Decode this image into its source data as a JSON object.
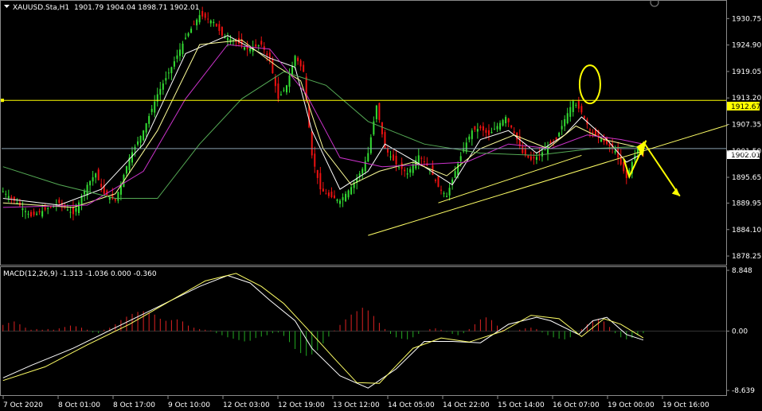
{
  "header": {
    "symbol": "XAUUSD.Sta,H1",
    "ohlc": "1901.79 1904.04 1898.71 1902.01"
  },
  "chart_data": [
    {
      "type": "candlestick",
      "title": "XAUUSD.Sta,H1",
      "ylim": [
        1876.5,
        1934.5
      ],
      "y_ticks": [
        "1930.75",
        "1924.90",
        "1919.05",
        "1913.20",
        "1907.35",
        "1901.50",
        "1895.65",
        "1889.95",
        "1884.10",
        "1878.25"
      ],
      "x_ticks": [
        "7 Oct 2020",
        "8 Oct 01:00",
        "8 Oct 17:00",
        "9 Oct 10:00",
        "12 Oct 03:00",
        "12 Oct 19:00",
        "13 Oct 12:00",
        "14 Oct 05:00",
        "14 Oct 22:00",
        "15 Oct 14:00",
        "16 Oct 07:00",
        "19 Oct 00:00",
        "19 Oct 16:00"
      ],
      "price_labels": {
        "resistance": "1912.67",
        "current": "1902.01"
      },
      "resistance_level": 1912.67,
      "current_price": 1902.01,
      "close_path": [
        [
          0,
          1892.5
        ],
        [
          5,
          1890.0
        ],
        [
          10,
          1887.0
        ],
        [
          15,
          1888.5
        ],
        [
          20,
          1890.0
        ],
        [
          25,
          1887.5
        ],
        [
          30,
          1894.0
        ],
        [
          33,
          1896.5
        ],
        [
          36,
          1892.0
        ],
        [
          40,
          1890.5
        ],
        [
          45,
          1900.0
        ],
        [
          50,
          1906.0
        ],
        [
          55,
          1914.0
        ],
        [
          60,
          1920.0
        ],
        [
          65,
          1926.5
        ],
        [
          70,
          1931.5
        ],
        [
          75,
          1930.0
        ],
        [
          78,
          1927.0
        ],
        [
          82,
          1926.0
        ],
        [
          87,
          1924.0
        ],
        [
          92,
          1925.0
        ],
        [
          95,
          1921.5
        ],
        [
          98,
          1913.0
        ],
        [
          101,
          1916.0
        ],
        [
          104,
          1922.5
        ],
        [
          107,
          1919.0
        ],
        [
          110,
          1900.5
        ],
        [
          113,
          1893.0
        ],
        [
          116,
          1891.5
        ],
        [
          120,
          1890.5
        ],
        [
          124,
          1893.5
        ],
        [
          128,
          1897.5
        ],
        [
          130,
          1901.0
        ],
        [
          133,
          1911.5
        ],
        [
          136,
          1902.0
        ],
        [
          140,
          1898.5
        ],
        [
          144,
          1896.5
        ],
        [
          148,
          1900.5
        ],
        [
          152,
          1897.5
        ],
        [
          155,
          1893.5
        ],
        [
          158,
          1891.5
        ],
        [
          161,
          1897.0
        ],
        [
          164,
          1902.0
        ],
        [
          167,
          1906.0
        ],
        [
          170,
          1906.5
        ],
        [
          173,
          1905.0
        ],
        [
          176,
          1907.0
        ],
        [
          179,
          1909.0
        ],
        [
          182,
          1905.5
        ],
        [
          185,
          1901.0
        ],
        [
          188,
          1899.5
        ],
        [
          191,
          1900.5
        ],
        [
          194,
          1902.5
        ],
        [
          197,
          1904.0
        ],
        [
          200,
          1908.5
        ],
        [
          203,
          1912.5
        ],
        [
          206,
          1910.0
        ],
        [
          209,
          1906.0
        ],
        [
          212,
          1904.5
        ],
        [
          215,
          1903.0
        ],
        [
          218,
          1901.5
        ],
        [
          220,
          1898.5
        ],
        [
          222,
          1895.5
        ],
        [
          224,
          1899.0
        ],
        [
          226,
          1902.0
        ],
        [
          228,
          1901.5
        ]
      ],
      "trendlines": [
        {
          "from": [
            130,
            1882.8
          ],
          "to": [
            258,
            1907.2
          ]
        },
        {
          "from": [
            155,
            1890.0
          ],
          "to": [
            206,
            1900.5
          ]
        }
      ],
      "forecast_path": [
        [
          228,
          1903.5
        ],
        [
          241,
          1891.5
        ]
      ],
      "series": [
        {
          "name": "MA fast",
          "color": "#ffffff",
          "values": [
            [
              0,
              1891
            ],
            [
              20,
              1889.5
            ],
            [
              35,
              1893
            ],
            [
              50,
              1903
            ],
            [
              65,
              1923
            ],
            [
              80,
              1927
            ],
            [
              95,
              1922
            ],
            [
              104,
              1920
            ],
            [
              110,
              1906
            ],
            [
              120,
              1893
            ],
            [
              130,
              1897
            ],
            [
              136,
              1903
            ],
            [
              150,
              1898
            ],
            [
              160,
              1894
            ],
            [
              170,
              1904
            ],
            [
              180,
              1906
            ],
            [
              190,
              1901
            ],
            [
              200,
              1905
            ],
            [
              206,
              1909
            ],
            [
              215,
              1904
            ],
            [
              222,
              1899
            ],
            [
              228,
              1901
            ]
          ]
        },
        {
          "name": "MA mid",
          "color": "#ffff99",
          "values": [
            [
              0,
              1890
            ],
            [
              25,
              1889
            ],
            [
              40,
              1892
            ],
            [
              55,
              1906
            ],
            [
              70,
              1925
            ],
            [
              85,
              1926
            ],
            [
              98,
              1920
            ],
            [
              106,
              1917
            ],
            [
              114,
              1902
            ],
            [
              124,
              1894
            ],
            [
              134,
              1897
            ],
            [
              146,
              1899
            ],
            [
              158,
              1896
            ],
            [
              170,
              1902
            ],
            [
              182,
              1905
            ],
            [
              194,
              1902
            ],
            [
              204,
              1907
            ],
            [
              214,
              1904
            ],
            [
              228,
              1902
            ]
          ]
        },
        {
          "name": "MA slow",
          "color": "#cc33cc",
          "values": [
            [
              0,
              1889
            ],
            [
              30,
              1889.5
            ],
            [
              50,
              1897
            ],
            [
              65,
              1913
            ],
            [
              80,
              1925
            ],
            [
              95,
              1924
            ],
            [
              108,
              1914
            ],
            [
              120,
              1900
            ],
            [
              135,
              1898
            ],
            [
              150,
              1898.5
            ],
            [
              165,
              1899
            ],
            [
              180,
              1903
            ],
            [
              195,
              1902
            ],
            [
              208,
              1905
            ],
            [
              220,
              1904
            ],
            [
              228,
              1903
            ]
          ]
        },
        {
          "name": "MA long",
          "color": "#55aa55",
          "values": [
            [
              0,
              1898
            ],
            [
              20,
              1894
            ],
            [
              40,
              1891
            ],
            [
              55,
              1891
            ],
            [
              70,
              1903
            ],
            [
              85,
              1913
            ],
            [
              100,
              1919
            ],
            [
              115,
              1916
            ],
            [
              130,
              1908
            ],
            [
              150,
              1903
            ],
            [
              170,
              1901
            ],
            [
              190,
              1900.5
            ],
            [
              210,
              1902
            ],
            [
              228,
              1902.5
            ]
          ]
        }
      ]
    },
    {
      "type": "macd",
      "title": "MACD(12,26,9) -1.313 -1.036 0.000 -0.360",
      "ylim": [
        -9.2,
        9.2
      ],
      "y_ticks": [
        "8.848",
        "0.00",
        "-8.639"
      ],
      "histogram": [
        0.9,
        1.2,
        1.4,
        1.0,
        0.5,
        0.2,
        0.3,
        0.2,
        0.3,
        0.2,
        0.4,
        0.6,
        0.8,
        0.7,
        0.5,
        0.2,
        -0.2,
        -0.3,
        0.2,
        0.5,
        1.0,
        1.6,
        2.1,
        2.5,
        2.8,
        2.9,
        2.7,
        2.4,
        1.8,
        1.5,
        1.6,
        1.7,
        1.4,
        0.8,
        0.5,
        0.3,
        0.2,
        0.1,
        -0.3,
        -0.6,
        -0.9,
        -1.1,
        -1.3,
        -1.5,
        -1.4,
        -1.0,
        -0.8,
        -0.6,
        -0.3,
        -0.2,
        -0.7,
        -1.6,
        -2.6,
        -3.2,
        -3.6,
        -3.4,
        -2.8,
        -1.8,
        -0.8,
        0.1,
        0.9,
        1.7,
        2.4,
        2.9,
        3.4,
        3.0,
        2.2,
        1.2,
        0.3,
        -0.4,
        -0.9,
        -1.1,
        -1.2,
        -0.9,
        -0.4,
        0.0,
        0.3,
        0.4,
        0.2,
        -0.1,
        -0.4,
        -0.6,
        -0.3,
        0.3,
        1.0,
        1.7,
        2.0,
        1.6,
        0.8,
        0.2,
        -0.1,
        0.0,
        0.2,
        0.4,
        0.5,
        0.3,
        -0.2,
        -0.6,
        -0.9,
        -1.1,
        -1.2,
        -0.9,
        -0.4,
        0.3,
        1.0,
        1.5,
        1.8,
        1.4,
        0.6,
        -0.3,
        -0.9,
        -1.2,
        -1.0,
        -0.6,
        -0.3
      ],
      "series": [
        {
          "name": "MACD",
          "color": "#ffffff",
          "values": [
            [
              0,
              -6.8
            ],
            [
              10,
              -5.0
            ],
            [
              25,
              -2.5
            ],
            [
              40,
              0.5
            ],
            [
              55,
              3.5
            ],
            [
              70,
              6.5
            ],
            [
              80,
              8.1
            ],
            [
              88,
              7.0
            ],
            [
              95,
              4.5
            ],
            [
              104,
              1.5
            ],
            [
              110,
              -2.5
            ],
            [
              120,
              -6.5
            ],
            [
              130,
              -8.3
            ],
            [
              140,
              -5.5
            ],
            [
              150,
              -1.5
            ],
            [
              160,
              -1.5
            ],
            [
              170,
              -1.7
            ],
            [
              180,
              1.0
            ],
            [
              190,
              2.0
            ],
            [
              195,
              1.5
            ],
            [
              205,
              -0.5
            ],
            [
              210,
              1.5
            ],
            [
              215,
              2.0
            ],
            [
              222,
              -0.5
            ],
            [
              228,
              -1.3
            ]
          ]
        },
        {
          "name": "Signal",
          "color": "#ffff66",
          "values": [
            [
              0,
              -7.2
            ],
            [
              15,
              -5.2
            ],
            [
              30,
              -2.0
            ],
            [
              45,
              1.0
            ],
            [
              60,
              4.5
            ],
            [
              72,
              7.3
            ],
            [
              83,
              8.4
            ],
            [
              92,
              6.5
            ],
            [
              100,
              4.0
            ],
            [
              108,
              0.5
            ],
            [
              118,
              -4.0
            ],
            [
              126,
              -7.5
            ],
            [
              134,
              -7.6
            ],
            [
              146,
              -2.5
            ],
            [
              156,
              -1.0
            ],
            [
              166,
              -1.6
            ],
            [
              178,
              0.0
            ],
            [
              188,
              2.3
            ],
            [
              198,
              1.8
            ],
            [
              206,
              -0.8
            ],
            [
              214,
              1.8
            ],
            [
              220,
              1.0
            ],
            [
              228,
              -1.0
            ]
          ]
        }
      ]
    }
  ],
  "annotations": {
    "ellipse_color": "#ffff00",
    "arrow_color": "#ffff00"
  }
}
